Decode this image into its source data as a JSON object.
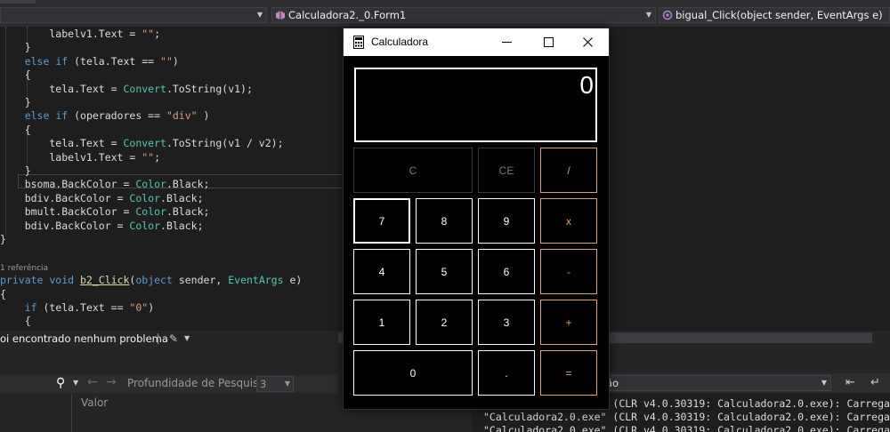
{
  "navbar": {
    "left_dropdown": "",
    "class_dropdown": "Calculadora2._0.Form1",
    "member_dropdown": "bigual_Click(object sender, EventArgs e)"
  },
  "code_lines": [
    [
      {
        "t": "        labelv1.Text = "
      },
      {
        "t": "\"\"",
        "c": "str"
      },
      {
        "t": ";"
      }
    ],
    [
      {
        "t": "    }"
      }
    ],
    [
      {
        "t": "    "
      },
      {
        "t": "else if",
        "c": "kw"
      },
      {
        "t": " (tela.Text == "
      },
      {
        "t": "\"\"",
        "c": "str"
      },
      {
        "t": ")"
      }
    ],
    [
      {
        "t": "    {"
      }
    ],
    [
      {
        "t": "        tela.Text = "
      },
      {
        "t": "Convert",
        "c": "typ"
      },
      {
        "t": ".ToString(v1);"
      }
    ],
    [
      {
        "t": "    }"
      }
    ],
    [
      {
        "t": "    "
      },
      {
        "t": "else if",
        "c": "kw"
      },
      {
        "t": " (operadores == "
      },
      {
        "t": "\"div\"",
        "c": "str"
      },
      {
        "t": " )"
      }
    ],
    [
      {
        "t": "    {"
      }
    ],
    [
      {
        "t": "        tela.Text = "
      },
      {
        "t": "Convert",
        "c": "typ"
      },
      {
        "t": ".ToString(v1 / v2);"
      }
    ],
    [
      {
        "t": "        labelv1.Text = "
      },
      {
        "t": "\"\"",
        "c": "str"
      },
      {
        "t": ";"
      }
    ],
    [
      {
        "t": "    }"
      }
    ],
    [
      {
        "t": "    bsoma.BackColor = "
      },
      {
        "t": "Color",
        "c": "typ"
      },
      {
        "t": ".Black;"
      }
    ],
    [
      {
        "t": "    bdiv.BackColor = "
      },
      {
        "t": "Color",
        "c": "typ"
      },
      {
        "t": ".Black;"
      }
    ],
    [
      {
        "t": "    bmult.BackColor = "
      },
      {
        "t": "Color",
        "c": "typ"
      },
      {
        "t": ".Black;"
      }
    ],
    [
      {
        "t": "    bdiv.BackColor = "
      },
      {
        "t": "Color",
        "c": "typ"
      },
      {
        "t": ".Black;"
      }
    ],
    [
      {
        "t": "}"
      }
    ],
    [
      {
        "t": ""
      }
    ],
    [
      {
        "t": "1 referência",
        "c": "codelens"
      }
    ],
    [
      {
        "t": "private void",
        "c": "kw"
      },
      {
        "t": " "
      },
      {
        "t": "b2_Click",
        "c": "fn"
      },
      {
        "t": "("
      },
      {
        "t": "object",
        "c": "kw"
      },
      {
        "t": " sender, "
      },
      {
        "t": "EventArgs",
        "c": "typ"
      },
      {
        "t": " e)"
      }
    ],
    [
      {
        "t": "{"
      }
    ],
    [
      {
        "t": "    "
      },
      {
        "t": "if",
        "c": "kw"
      },
      {
        "t": " (tela.Text == "
      },
      {
        "t": "\"0\"",
        "c": "str"
      },
      {
        "t": ")"
      }
    ],
    [
      {
        "t": "    {"
      }
    ],
    [
      {
        "t": "        tela.Text = "
      },
      {
        "t": "\"\"",
        "c": "str"
      },
      {
        "t": ";"
      }
    ]
  ],
  "status": {
    "message": "oi encontrado nenhum problema"
  },
  "search_panel": {
    "depth_label": "Profundidade de Pesquisa:",
    "depth_value": "3",
    "column_header": "Valor"
  },
  "output_panel": {
    "dropdown_text": "ão",
    "lines": [
      "\"Calculadora2.0.exe\" (CLR v4.0.30319: Calculadora2.0.exe): Carregad",
      "\"Calculadora2.0.exe\" (CLR v4.0.30319: Calculadora2.0.exe): Carregad",
      "\"Calculadora2.0.exe\" (CLR v4.0.30319: Calculadora2.0.exe): Carregad"
    ]
  },
  "calculator": {
    "title": "Calculadora",
    "display": "0",
    "keys": {
      "c": "C",
      "ce": "CE",
      "div": "/",
      "k7": "7",
      "k8": "8",
      "k9": "9",
      "mul": "x",
      "k4": "4",
      "k5": "5",
      "k6": "6",
      "sub": "-",
      "k1": "1",
      "k2": "2",
      "k3": "3",
      "add": "+",
      "k0": "0",
      "dot": ".",
      "eq": "="
    }
  },
  "colors": {
    "editor_bg": "#1e1e1e",
    "keyword": "#569cd6",
    "string": "#d69d85",
    "type": "#4ec9b0",
    "operator_key": "#e8a049"
  }
}
